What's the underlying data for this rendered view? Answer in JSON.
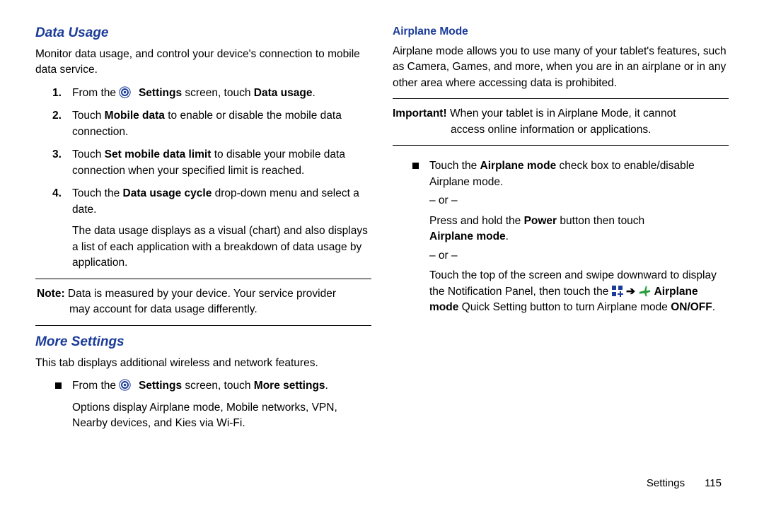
{
  "left": {
    "data_usage_title": "Data Usage",
    "data_usage_intro": "Monitor data usage, and control your device's connection to mobile data service.",
    "step1_pre": "From the ",
    "step1_bold1": "Settings",
    "step1_mid": " screen, touch ",
    "step1_bold2": "Data usage",
    "step1_end": ".",
    "step2_pre": "Touch ",
    "step2_bold": "Mobile data",
    "step2_end": " to enable or disable the mobile data connection.",
    "step3_pre": "Touch ",
    "step3_bold": "Set mobile data limit",
    "step3_end": " to disable your mobile data connection when your specified limit is reached.",
    "step4_pre": "Touch the ",
    "step4_bold": "Data usage cycle",
    "step4_end": " drop-down menu and select a date.",
    "step4_para": "The data usage displays as a visual (chart) and also displays a list of each application with a breakdown of data usage by application.",
    "note_label": "Note:",
    "note_text_l1": " Data is measured by your device. Your service provider",
    "note_text_l2": "may account for data usage differently.",
    "more_settings_title": "More Settings",
    "more_settings_intro": "This tab displays additional wireless and network features.",
    "ms_bullet_pre": "From the ",
    "ms_bullet_bold1": "Settings",
    "ms_bullet_mid": " screen, touch ",
    "ms_bullet_bold2": "More settings",
    "ms_bullet_end": ".",
    "ms_bullet_para": "Options display Airplane mode, Mobile networks, VPN, Nearby devices, and Kies via Wi-Fi."
  },
  "right": {
    "airplane_title": "Airplane Mode",
    "airplane_intro": "Airplane mode allows you to use many of your tablet's features, such as Camera, Games, and more, when you are in an airplane or in any other area where accessing data is prohibited.",
    "important_label": "Important!",
    "important_text_l1": " When your tablet is in Airplane Mode, it cannot",
    "important_text_l2": "access online information or applications.",
    "b1_pre": "Touch the ",
    "b1_bold": "Airplane mode",
    "b1_end": " check box to enable/disable Airplane mode.",
    "or1": "– or –",
    "b2_pre": "Press and hold the ",
    "b2_bold": "Power",
    "b2_mid": " button then touch ",
    "b2_bold2": "Airplane mode",
    "b2_end": ".",
    "or2": "– or –",
    "b3_l1": "Touch the top of the screen and swipe downward to display the Notification Panel, then touch the ",
    "b3_bold_mode": "Airplane mode",
    "b3_after_mode": " Quick Setting button to turn Airplane mode ",
    "b3_bold_onoff": "ON/OFF",
    "b3_end": "."
  },
  "footer": {
    "section": "Settings",
    "page": "115"
  },
  "icons": {
    "settings": "settings-gear-icon",
    "grid": "notification-grid-icon",
    "arrow": "arrow-right-icon",
    "plane": "airplane-icon"
  }
}
